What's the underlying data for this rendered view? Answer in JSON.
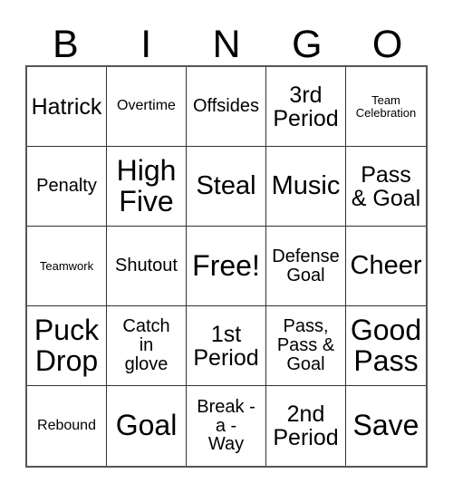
{
  "card": {
    "title_letters": [
      "B",
      "I",
      "N",
      "G",
      "O"
    ],
    "columns": 5,
    "rows": 5,
    "colors": {
      "background": "#ffffff",
      "text": "#000000",
      "grid_line": "#333333",
      "outer_border": "#555555"
    },
    "cells": [
      {
        "text": "Hatrick",
        "size": "lg"
      },
      {
        "text": "Overtime",
        "size": "sm"
      },
      {
        "text": "Offsides",
        "size": "md"
      },
      {
        "text": "3rd\nPeriod",
        "size": "lg"
      },
      {
        "text": "Team\nCelebration",
        "size": "xs"
      },
      {
        "text": "Penalty",
        "size": "md"
      },
      {
        "text": "High\nFive",
        "size": "xxl"
      },
      {
        "text": "Steal",
        "size": "xl"
      },
      {
        "text": "Music",
        "size": "xl"
      },
      {
        "text": "Pass\n& Goal",
        "size": "lg"
      },
      {
        "text": "Teamwork",
        "size": "xs"
      },
      {
        "text": "Shutout",
        "size": "md"
      },
      {
        "text": "Free!",
        "size": "xxl"
      },
      {
        "text": "Defense\nGoal",
        "size": "md"
      },
      {
        "text": "Cheer",
        "size": "xl"
      },
      {
        "text": "Puck\nDrop",
        "size": "xxl"
      },
      {
        "text": "Catch\nin\nglove",
        "size": "md"
      },
      {
        "text": "1st\nPeriod",
        "size": "lg"
      },
      {
        "text": "Pass,\nPass &\nGoal",
        "size": "md"
      },
      {
        "text": "Good\nPass",
        "size": "xxl"
      },
      {
        "text": "Rebound",
        "size": "sm"
      },
      {
        "text": "Goal",
        "size": "xxl"
      },
      {
        "text": "Break -\na -\nWay",
        "size": "md"
      },
      {
        "text": "2nd\nPeriod",
        "size": "lg"
      },
      {
        "text": "Save",
        "size": "xxl"
      }
    ]
  }
}
